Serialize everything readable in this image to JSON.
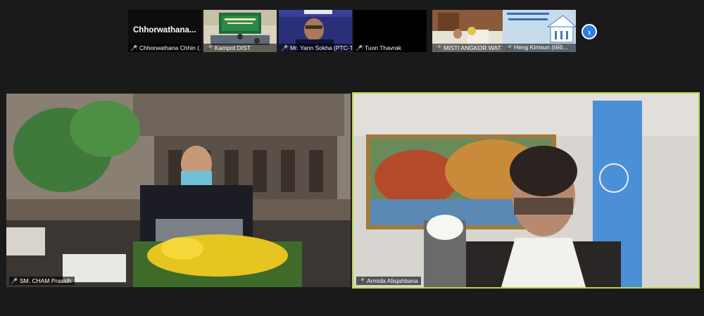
{
  "participants_strip": [
    {
      "tile_name": "Chhorwathana...",
      "label": "Chhorwathana Chhin (...",
      "muted": true
    },
    {
      "label": "Kampot DIST",
      "muted": true
    },
    {
      "label": "Mr. Yann Sokha (PTC-T...",
      "muted": true
    },
    {
      "label": "Tuon Thavrak",
      "muted": true
    },
    {
      "label": "MISTI ANGKOR WAT T...",
      "muted": true
    },
    {
      "label": "Heng Kimsun (ម៉េង...",
      "muted": true
    }
  ],
  "next_page_icon": "chevron-right-icon",
  "main_videos": [
    {
      "label": "SM. CHAM Prasidh"
    },
    {
      "label": "Armida Alisjahbana",
      "active_speaker": true
    }
  ],
  "colors": {
    "background": "#1a1a1a",
    "active_speaker_border": "#b5d94a",
    "next_button": "#2b7de9",
    "muted_mic": "#e0332f"
  }
}
